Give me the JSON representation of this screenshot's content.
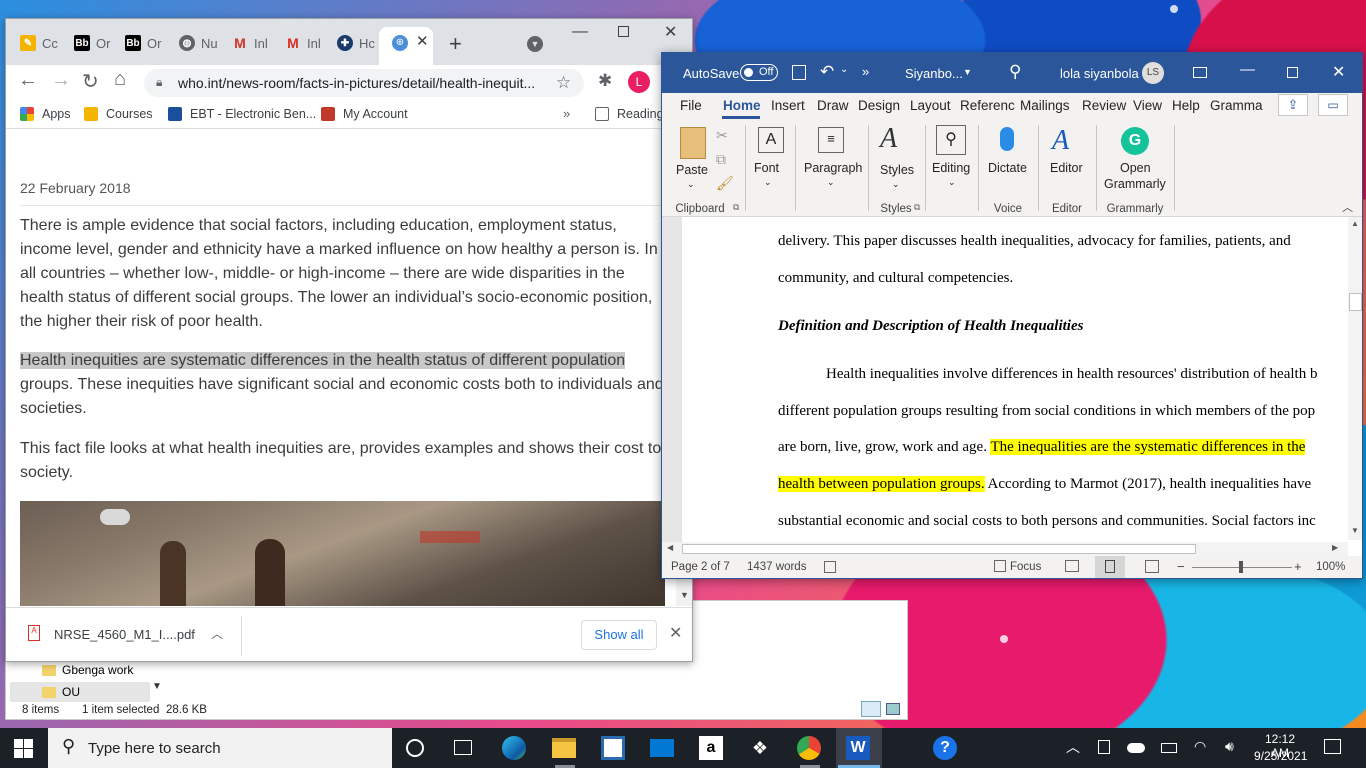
{
  "chrome": {
    "tabs": [
      {
        "label": "Cc",
        "icon": "courses-icon",
        "color": "#f4b400"
      },
      {
        "label": "Or",
        "icon": "blackboard-icon",
        "color": "#000000"
      },
      {
        "label": "Or",
        "icon": "blackboard-icon",
        "color": "#000000"
      },
      {
        "label": "Nu",
        "icon": "globe-icon",
        "color": "#5f6368"
      },
      {
        "label": "Inl",
        "icon": "gmail-icon",
        "color": "#d93025"
      },
      {
        "label": "Inl",
        "icon": "gmail-icon",
        "color": "#d93025"
      },
      {
        "label": "Hc",
        "icon": "site-icon",
        "color": "#1a3a6a"
      }
    ],
    "url": "who.int/news-room/facts-in-pictures/detail/health-inequit...",
    "profile_initial": "L",
    "bookmarks": [
      "Apps",
      "Courses",
      "EBT - Electronic Ben...",
      "My Account"
    ],
    "reading_list": "Reading",
    "page": {
      "date": "22 February 2018",
      "para1": "There is ample evidence that social factors, including education, employment status, income level, gender and ethnicity have a marked influence on how healthy a person is. In all countries – whether low-, middle- or high-income – there are wide disparities in the health status of different social groups. The lower an individual’s socio-economic position, the higher their risk of poor health.",
      "para2_highlight": "Health inequities are systematic differences in the health status of different population",
      "para2_rest": "groups. These inequities have significant social and economic costs both to individuals and societies.",
      "para3": "This fact file looks at what health inequities are, provides examples and shows their cost to society."
    },
    "download": {
      "filename": "NRSE_4560_M1_I....pdf",
      "show_all": "Show all"
    }
  },
  "explorer": {
    "items": [
      "Gbenga work",
      "OU"
    ],
    "status_count": "8 items",
    "status_selected": "1 item selected",
    "status_size": "28.6 KB"
  },
  "word": {
    "autosave": "AutoSave",
    "autosave_state": "Off",
    "doc_name": "Siyanbo...",
    "user": "lola siyanbola",
    "user_initials": "LS",
    "menu": [
      "File",
      "Home",
      "Insert",
      "Draw",
      "Design",
      "Layout",
      "Referenc",
      "Mailings",
      "Review",
      "View",
      "Help",
      "Gramma"
    ],
    "ribbon": {
      "paste": "Paste",
      "clipboard": "Clipboard",
      "font": "Font",
      "paragraph": "Paragraph",
      "styles": "Styles",
      "styles_group": "Styles",
      "editing": "Editing",
      "dictate": "Dictate",
      "voice": "Voice",
      "editor": "Editor",
      "editor_group": "Editor",
      "open_grammarly_1": "Open",
      "open_grammarly_2": "Grammarly",
      "grammarly_group": "Grammarly"
    },
    "doc": {
      "line1": "delivery. This paper discusses health inequalities, advocacy for families, patients, and",
      "line2": "community, and cultural competencies.",
      "heading": "Definition and Description of Health Inequalities",
      "line3": "Health inequalities involve differences in health resources' distribution of health b",
      "line4": "different population groups resulting from social conditions in which members of the pop",
      "line5a": "are born, live, grow, work and age. ",
      "line5b": "The inequalities are the systematic differences in the",
      "line6a": "health between population groups.",
      "line6b": " According to Marmot (2017), health inequalities have",
      "line7": "substantial economic and social costs to both persons and communities. Social factors inc"
    },
    "status": {
      "page": "Page 2 of 7",
      "words": "1437 words",
      "focus": "Focus",
      "zoom": "100%"
    }
  },
  "taskbar": {
    "search_placeholder": "Type here to search",
    "time": "12:12 AM",
    "date": "9/25/2021"
  }
}
